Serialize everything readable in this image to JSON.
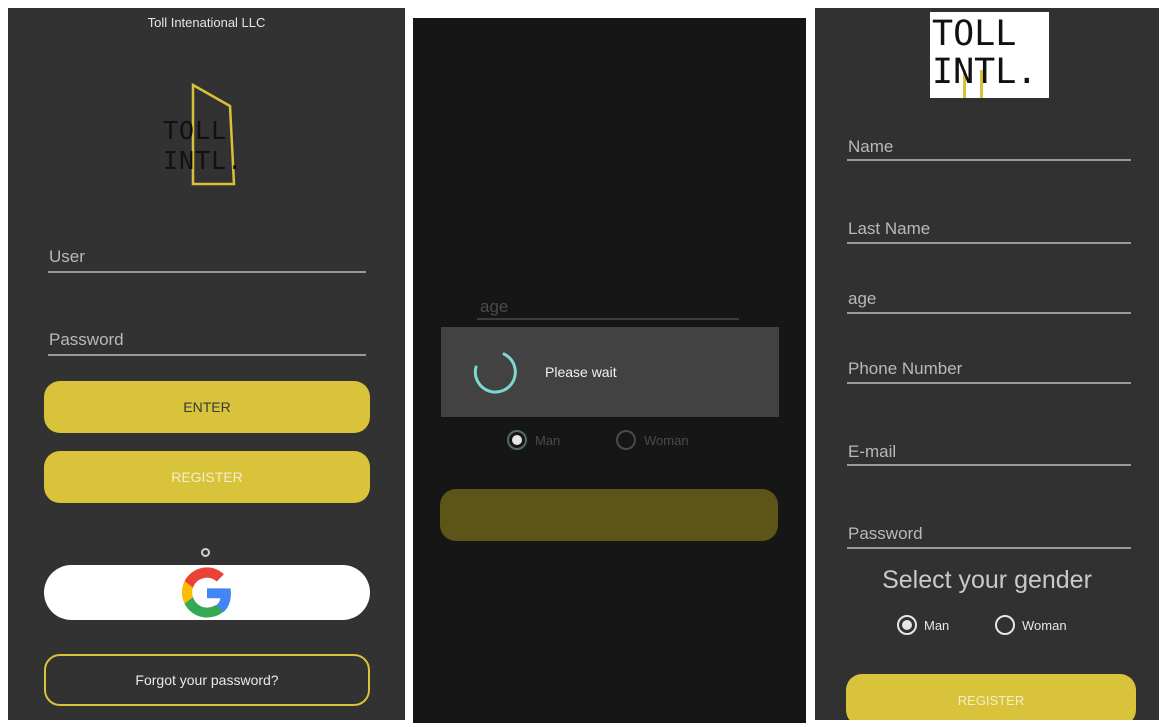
{
  "login": {
    "company_name": "Toll Intenational LLC",
    "logo_text_line1": "TOLL",
    "logo_text_line2": "INTL.",
    "user_label": "User",
    "password_label": "Password",
    "enter_button": "ENTER",
    "register_button": "REGISTER",
    "google_icon": "google-icon",
    "forgot_password": "Forgot your password?"
  },
  "loading": {
    "age_label": "age",
    "dialog_message": "Please wait",
    "gender_options": [
      "Man",
      "Woman"
    ],
    "selected_gender": "Man"
  },
  "register": {
    "logo_text_line1": "TOLL",
    "logo_text_line2": "INTL.",
    "fields": [
      "Name",
      "Last Name",
      "age",
      "Phone Number",
      "E-mail",
      "Password"
    ],
    "gender_title": "Select your gender",
    "gender_options": [
      "Man",
      "Woman"
    ],
    "selected_gender": "Man",
    "register_button": "REGISTER"
  },
  "colors": {
    "accent_yellow": "#d8c33a",
    "dark_bg": "#323232",
    "spinner": "#7dd8cf"
  }
}
